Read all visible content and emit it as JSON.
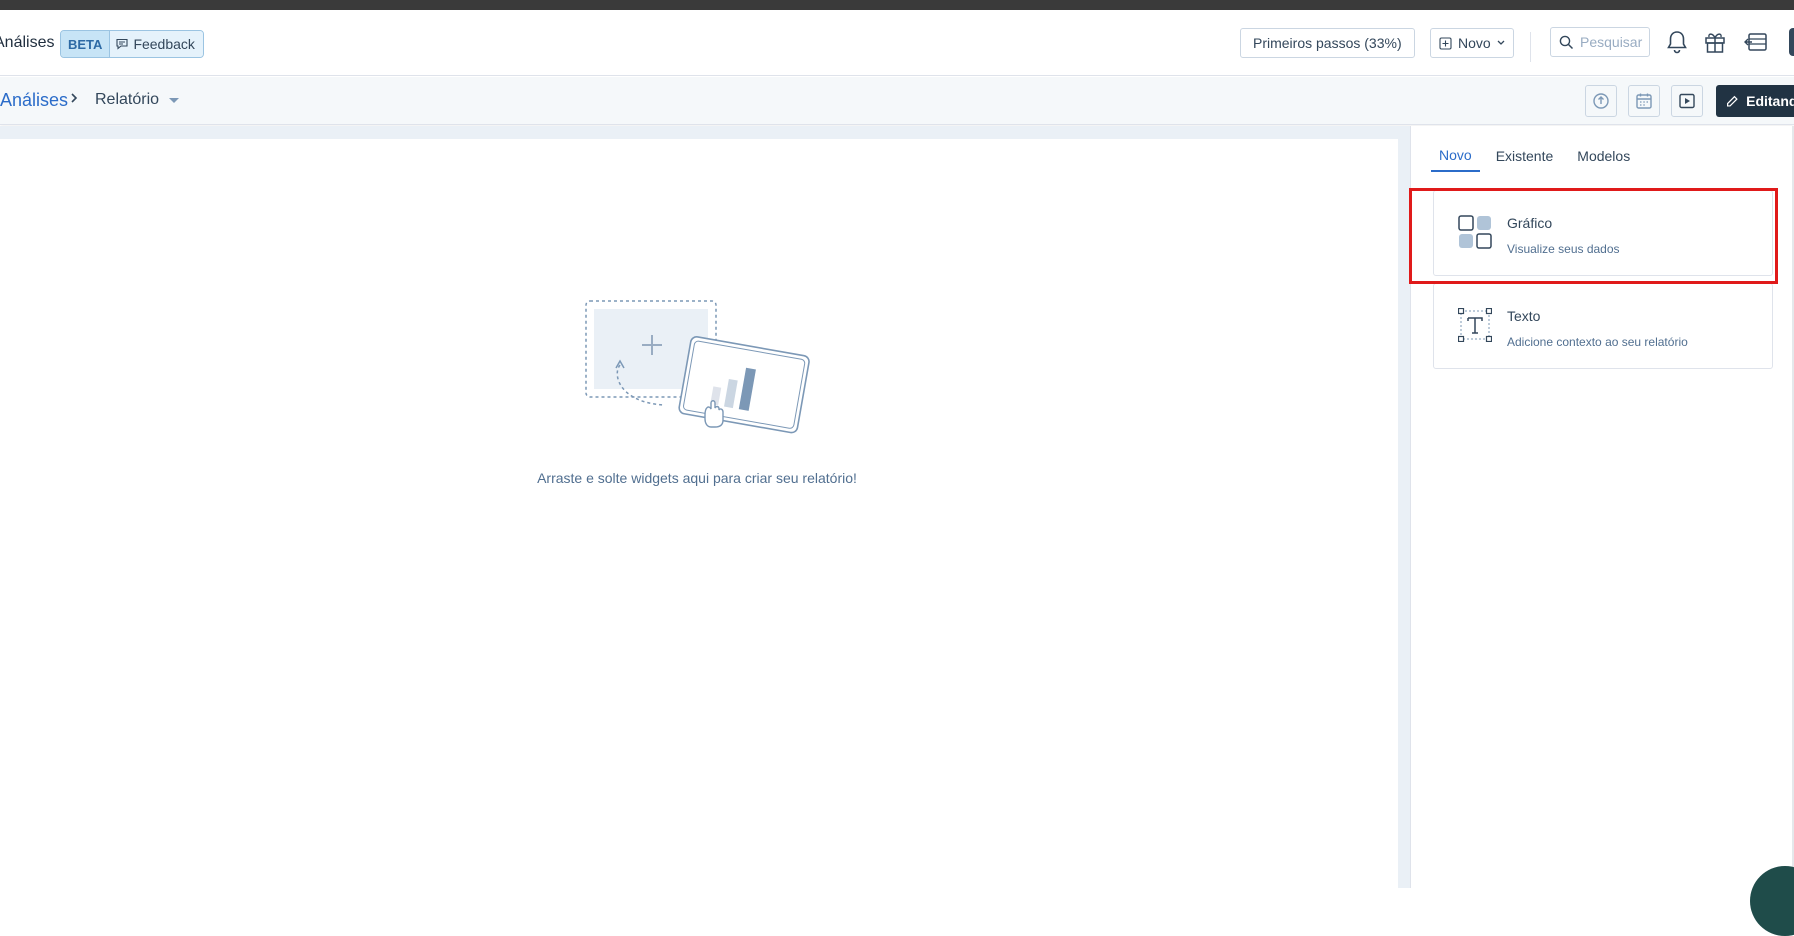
{
  "header": {
    "app_title": "Análises",
    "beta_label": "BETA",
    "feedback_label": "Feedback",
    "getting_started_label": "Primeiros passos (33%)",
    "new_label": "Novo",
    "search_placeholder": "Pesquisar"
  },
  "breadcrumb": {
    "parent": "Análises",
    "current": "Relatório"
  },
  "toolbar": {
    "edit_label": "Editando"
  },
  "canvas": {
    "empty_message": "Arraste e solte widgets aqui para criar seu relatório!"
  },
  "panel": {
    "tabs": [
      {
        "label": "Novo",
        "active": true
      },
      {
        "label": "Existente",
        "active": false
      },
      {
        "label": "Modelos",
        "active": false
      }
    ],
    "widgets": [
      {
        "title": "Gráfico",
        "description": "Visualize seus dados",
        "icon": "chart-widget-icon"
      },
      {
        "title": "Texto",
        "description": "Adicione contexto ao seu relatório",
        "icon": "text-widget-icon"
      }
    ]
  },
  "colors": {
    "link_blue": "#2b6cc9",
    "primary_dark": "#213343",
    "highlight_red": "#e01a1a"
  }
}
